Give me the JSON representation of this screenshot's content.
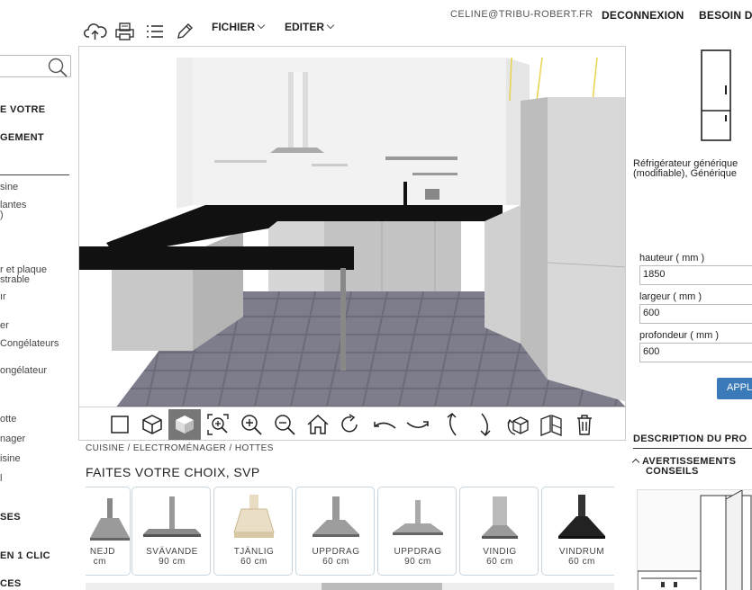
{
  "header": {
    "user_email": "CELINE@TRIBU-ROBERT.FR",
    "logout_label": "DECONNEXION",
    "help_label": "BESOIN D",
    "menus": [
      {
        "label": "FICHIER"
      },
      {
        "label": "EDITER"
      }
    ],
    "tools": [
      {
        "icon": "cloud-upload-icon"
      },
      {
        "icon": "print-icon"
      },
      {
        "icon": "list-icon"
      },
      {
        "icon": "pencil-icon"
      }
    ]
  },
  "sidebar": {
    "search_placeholder": "",
    "headings": [
      {
        "label": "E VOTRE"
      },
      {
        "label": "GEMENT"
      }
    ],
    "items": [
      {
        "label": "sine"
      },
      {
        "label": "lantes"
      },
      {
        "label": ")"
      },
      {
        "label": "r et plaque"
      },
      {
        "label": "strable"
      },
      {
        "label": "ır"
      },
      {
        "label": "er"
      },
      {
        "label": "Congélateurs"
      },
      {
        "label": "ongélateur"
      },
      {
        "label": "otte"
      },
      {
        "label": "nager"
      },
      {
        "label": "isine"
      },
      {
        "label": "l"
      }
    ],
    "bottom_headings": [
      {
        "label": "SES"
      },
      {
        "label": "EN 1 CLIC"
      },
      {
        "label": "CES"
      }
    ]
  },
  "view_tools": [
    {
      "icon": "square-view-icon",
      "active": false
    },
    {
      "icon": "cube-outline-icon",
      "active": false
    },
    {
      "icon": "cube-3d-icon",
      "active": true
    },
    {
      "icon": "zoom-fit-icon",
      "active": false
    },
    {
      "icon": "zoom-in-icon",
      "active": false
    },
    {
      "icon": "zoom-out-icon",
      "active": false
    },
    {
      "icon": "home-icon",
      "active": false
    },
    {
      "icon": "rotate-right-icon",
      "active": false
    },
    {
      "icon": "orbit-left-icon",
      "active": false
    },
    {
      "icon": "orbit-right-icon",
      "active": false
    },
    {
      "icon": "tilt-up-icon",
      "active": false
    },
    {
      "icon": "tilt-down-icon",
      "active": false
    },
    {
      "icon": "rotate-object-icon",
      "active": false
    },
    {
      "icon": "flip-icon",
      "active": false
    },
    {
      "icon": "trash-icon",
      "active": false
    }
  ],
  "catalogue": {
    "breadcrumb": "CUISINE / ELECTROMÉNAGER / HOTTES",
    "title": "FAITES VOTRE CHOIX, SVP",
    "products": [
      {
        "name": "NEJD",
        "size": "cm",
        "style": "pyramid"
      },
      {
        "name": "SVÄVANDE",
        "size": "90 cm",
        "style": "flat-wide"
      },
      {
        "name": "TJÄNLIG",
        "size": "60 cm",
        "style": "cream"
      },
      {
        "name": "UPPDRAG",
        "size": "60 cm",
        "style": "pyramid"
      },
      {
        "name": "UPPDRAG",
        "size": "90 cm",
        "style": "flat-wide"
      },
      {
        "name": "VINDIG",
        "size": "60 cm",
        "style": "glass"
      },
      {
        "name": "VINDRUM",
        "size": "60 cm",
        "style": "black"
      }
    ]
  },
  "panel": {
    "item_name_line1": "Réfrigérateur générique",
    "item_name_line2": "(modifiable), Générique",
    "fields": [
      {
        "label": "hauteur ( mm )",
        "value": "1850"
      },
      {
        "label": "largeur ( mm )",
        "value": "600"
      },
      {
        "label": "profondeur ( mm )",
        "value": "600"
      }
    ],
    "apply_label": "APPL",
    "description_heading": "DESCRIPTION DU PRO",
    "warnings_line1": "AVERTISSEMENTS",
    "warnings_line2": "CONSEILS"
  }
}
